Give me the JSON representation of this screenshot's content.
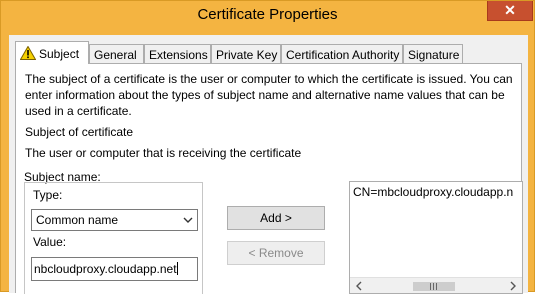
{
  "window": {
    "title": "Certificate Properties",
    "close_glyph": "✕"
  },
  "tabs": [
    {
      "label": "Subject",
      "active": true,
      "icon": "warning-icon"
    },
    {
      "label": "General"
    },
    {
      "label": "Extensions"
    },
    {
      "label": "Private Key"
    },
    {
      "label": "Certification Authority"
    },
    {
      "label": "Signature"
    }
  ],
  "subject": {
    "description": "The subject of a certificate is the user or computer to which the certificate is issued. You can enter information about the types of subject name and alternative name values that can be used in a certificate.",
    "section_title": "Subject of certificate",
    "section_desc": "The user or computer that is receiving the certificate",
    "subject_name_label": "Subject name:",
    "type_label": "Type:",
    "type_selected": "Common name",
    "value_label": "Value:",
    "value_text": "nbcloudproxy.cloudapp.net",
    "add_button": "Add >",
    "remove_button": "< Remove",
    "list_items": [
      "CN=mbcloudproxy.cloudapp.n"
    ]
  },
  "colors": {
    "titlebar": "#f4b441",
    "close": "#c7502f"
  }
}
